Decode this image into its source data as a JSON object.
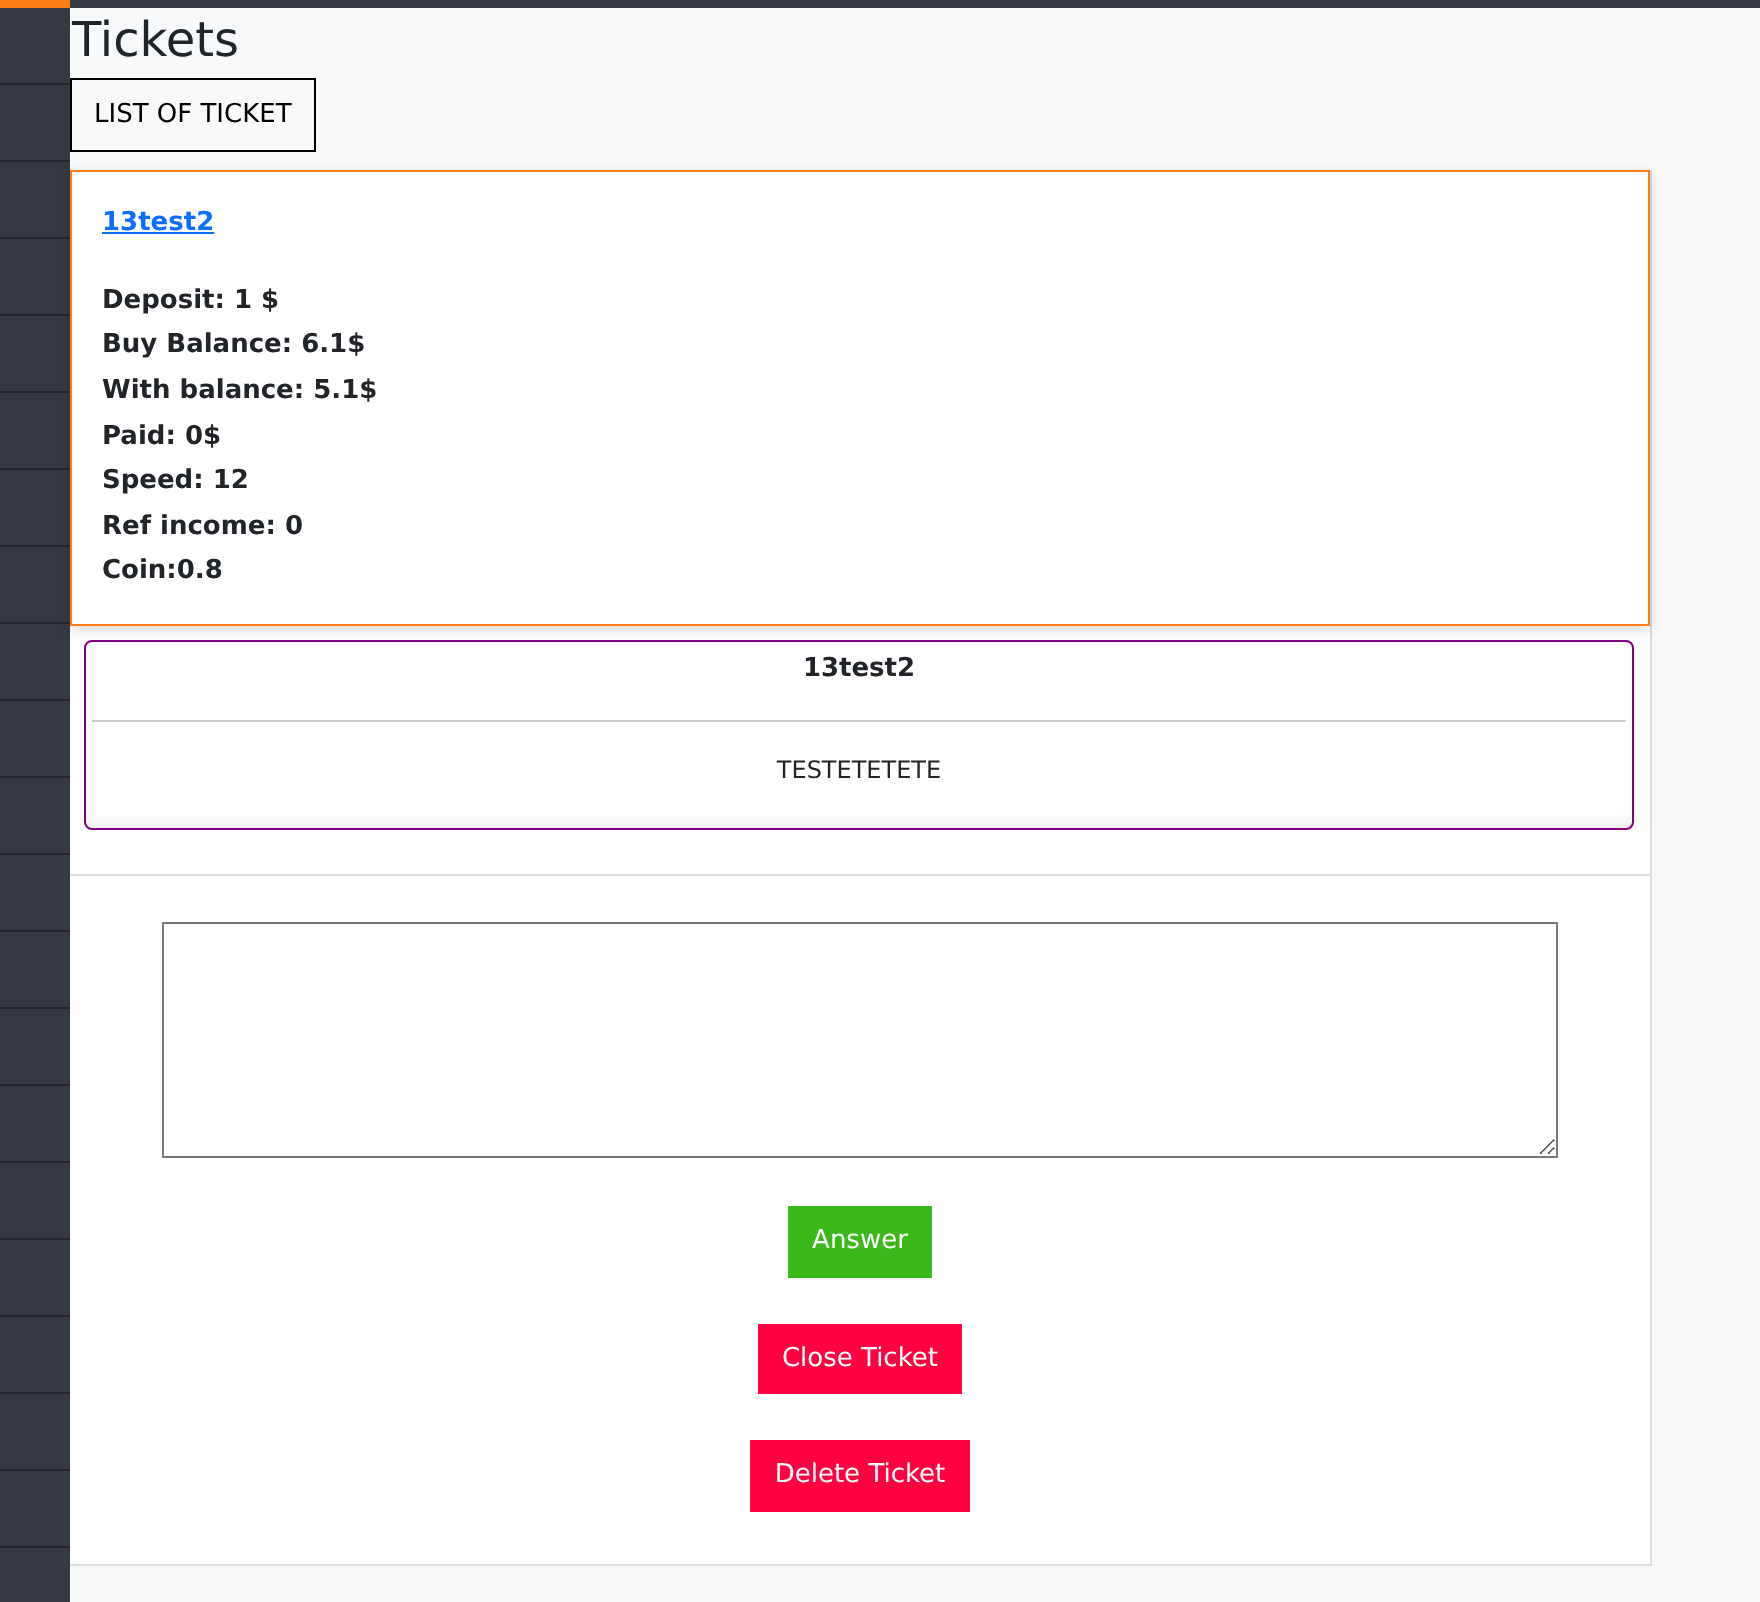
{
  "page_title": "Tickets",
  "list_button": "LIST OF TICKET",
  "ticket": {
    "link": "13test2",
    "stats": [
      "Deposit: 1 $",
      "Buy Balance: 6.1$",
      "With balance: 5.1$",
      "Paid: 0$",
      "Speed: 12",
      "Ref income: 0",
      "Coin:0.8"
    ]
  },
  "messages": [
    {
      "author": "13test2",
      "text": "TESTETETETE"
    }
  ],
  "actions": [
    {
      "label": "Answer",
      "kind": "success"
    },
    {
      "label": "Close Ticket",
      "kind": "danger"
    },
    {
      "label": "Delete Ticket",
      "kind": "danger"
    }
  ]
}
